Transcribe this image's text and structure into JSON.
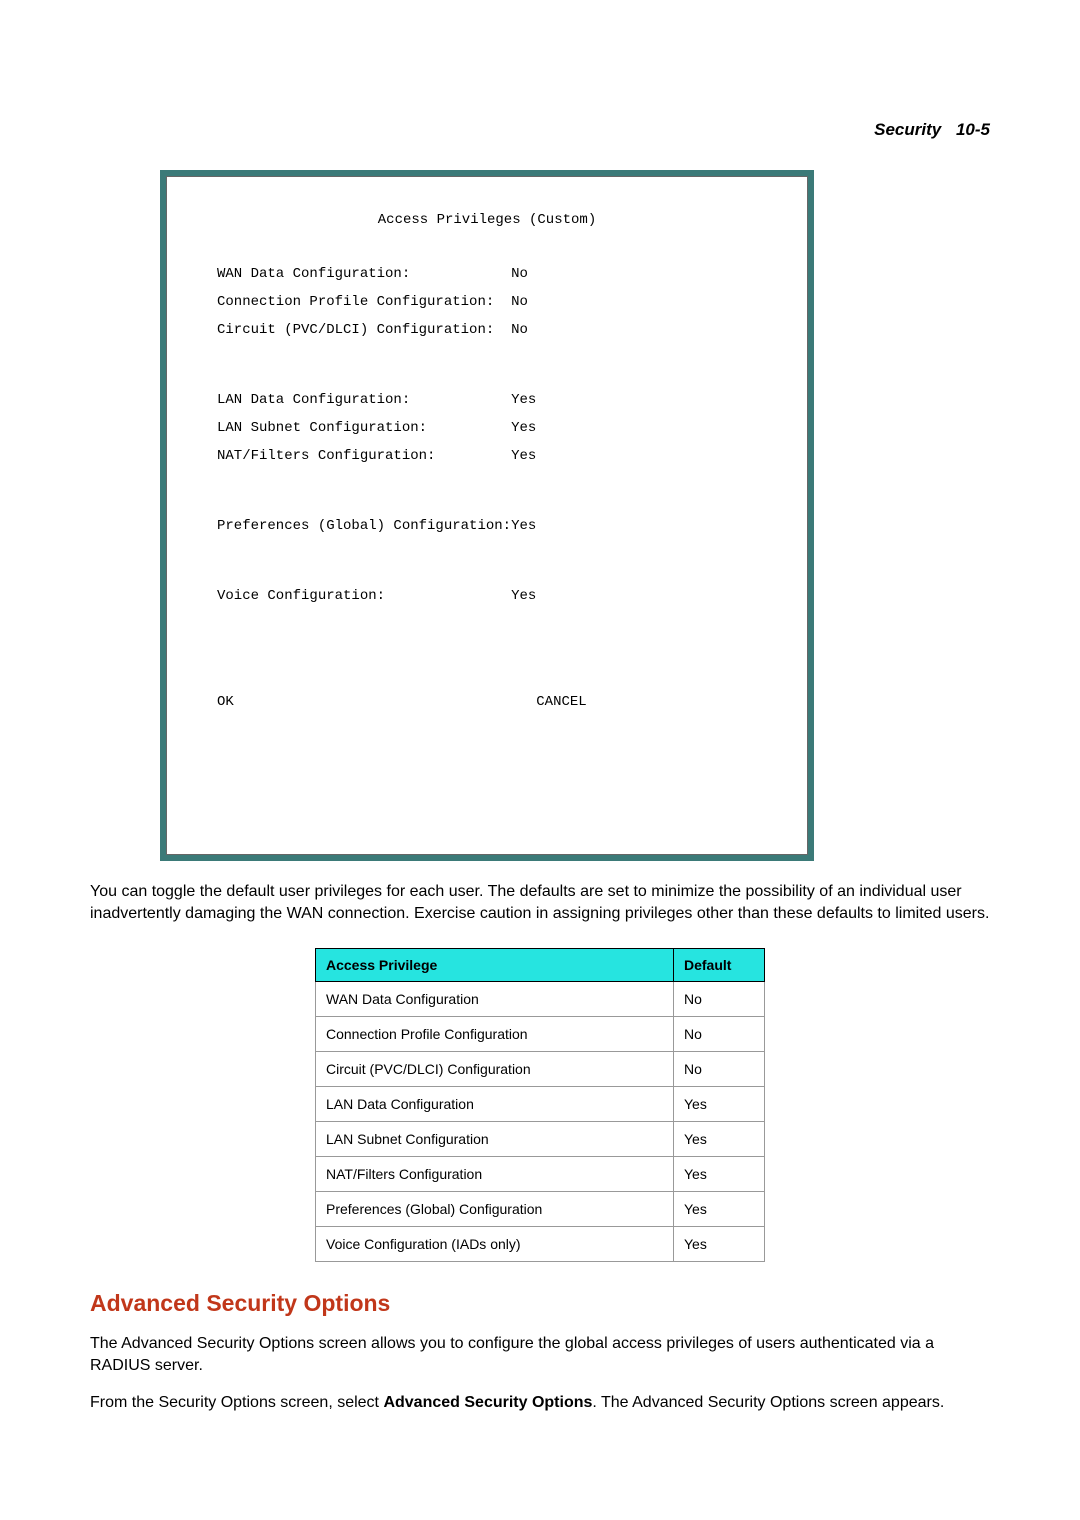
{
  "header": {
    "title": "Security",
    "page_ref": "10-5"
  },
  "terminal": {
    "title": "Access Privileges (Custom)",
    "group1": {
      "wan_data_label": "WAN Data Configuration:",
      "wan_data_value": "No",
      "conn_profile_label": "Connection Profile Configuration:",
      "conn_profile_value": "No",
      "circuit_label": "Circuit (PVC/DLCI) Configuration:",
      "circuit_value": "No"
    },
    "group2": {
      "lan_data_label": "LAN Data Configuration:",
      "lan_data_value": "Yes",
      "lan_subnet_label": "LAN Subnet Configuration:",
      "lan_subnet_value": "Yes",
      "nat_filters_label": "NAT/Filters Configuration:",
      "nat_filters_value": "Yes"
    },
    "group3": {
      "prefs_label": "Preferences (Global) Configuration:",
      "prefs_value": "Yes"
    },
    "group4": {
      "voice_label": "Voice Configuration:",
      "voice_value": "Yes"
    },
    "actions": {
      "ok": "OK",
      "cancel": "CANCEL"
    }
  },
  "paragraph1": "You can toggle the default user privileges for each user. The defaults are set to minimize the possibility of an individual user inadvertently damaging the WAN connection. Exercise caution in assigning privileges other than these defaults to limited users.",
  "table": {
    "headers": {
      "privilege": "Access Privilege",
      "default": "Default"
    },
    "rows": [
      {
        "privilege": "WAN Data Configuration",
        "default": "No"
      },
      {
        "privilege": "Connection Profile Configuration",
        "default": "No"
      },
      {
        "privilege": "Circuit (PVC/DLCI) Configuration",
        "default": "No"
      },
      {
        "privilege": "LAN Data Configuration",
        "default": "Yes"
      },
      {
        "privilege": "LAN Subnet Configuration",
        "default": "Yes"
      },
      {
        "privilege": "NAT/Filters Configuration",
        "default": "Yes"
      },
      {
        "privilege": "Preferences (Global) Configuration",
        "default": "Yes"
      },
      {
        "privilege": "Voice Configuration (IADs only)",
        "default": "Yes"
      }
    ]
  },
  "section_heading": "Advanced Security Options",
  "paragraph2": "The Advanced Security Options screen allows you to configure the global access privileges of users authenticated via a RADIUS server.",
  "nav_instruction": {
    "pre": "From the Security Options screen, select ",
    "bold": "Advanced Security Options",
    "post": ". The Advanced Security Options screen appears."
  }
}
